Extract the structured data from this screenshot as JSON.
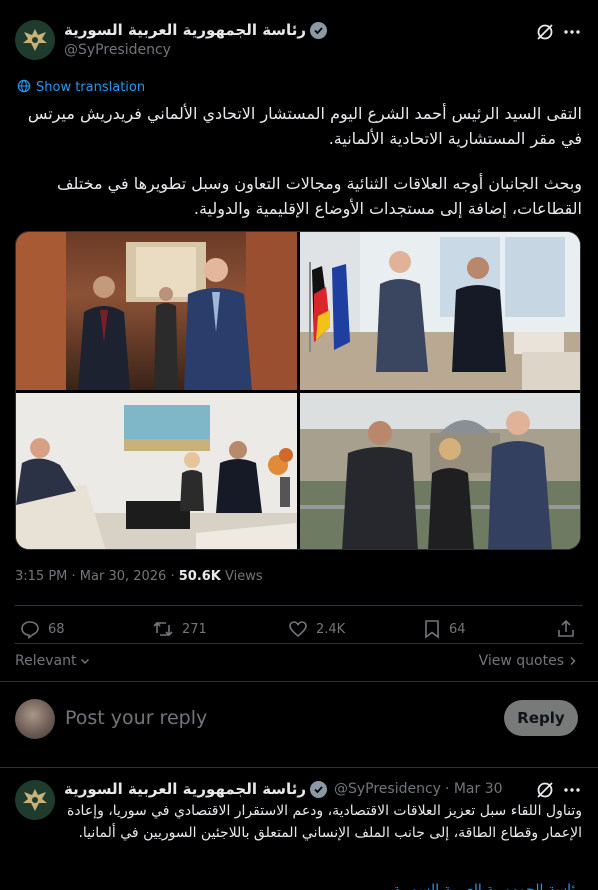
{
  "tweet": {
    "author_name": "رئاسة الجمهورية العربية السورية",
    "handle": "@SyPresidency",
    "show_translation": "Show translation",
    "text_p1": "التقى السيد الرئيس أحمد الشرع اليوم المستشار الاتحادي الألماني فريدريش ميرتس في مقر المستشارية الاتحادية الألمانية.",
    "text_p2": "وبحث الجانبان أوجه العلاقات الثنائية ومجالات التعاون وسبل تطويرها في مختلف القطاعات، إضافة إلى مستجدات الأوضاع الإقليمية والدولية.",
    "time": "3:15 PM · Mar 30, 2026 · ",
    "views_count": "50.6K",
    "views_label": " Views",
    "stats": {
      "replies": "68",
      "reposts": "271",
      "likes": "2.4K",
      "bookmarks": "64"
    },
    "icons": [
      "verified-icon",
      "grok-icon",
      "more-icon",
      "globe-icon",
      "reply-icon",
      "repost-icon",
      "like-icon",
      "bookmark-icon",
      "share-icon"
    ]
  },
  "sort": {
    "relevant": "Relevant",
    "view_quotes": "View quotes"
  },
  "composer": {
    "placeholder": "Post your reply",
    "button": "Reply"
  },
  "reply_tweet": {
    "author_name": "رئاسة الجمهورية العربية السورية",
    "handle": "@SyPresidency",
    "date": "· Mar 30",
    "text": "وتناول اللقاء سبل تعزيز العلاقات الاقتصادية، ودعم الاستقرار الاقتصادي في سوريا، وإعادة الإعمار وقطاع الطاقة، إلى جانب الملف الإنساني المتعلق باللاجئين السوريين في ألمانيا.",
    "partial_name": "رئاسة الجمهورية العربية السورية"
  },
  "colors": {
    "background": "#000000",
    "text": "#e7e9ea",
    "muted": "#71767b",
    "link": "#1d9bf0",
    "divider": "#2f3336"
  }
}
